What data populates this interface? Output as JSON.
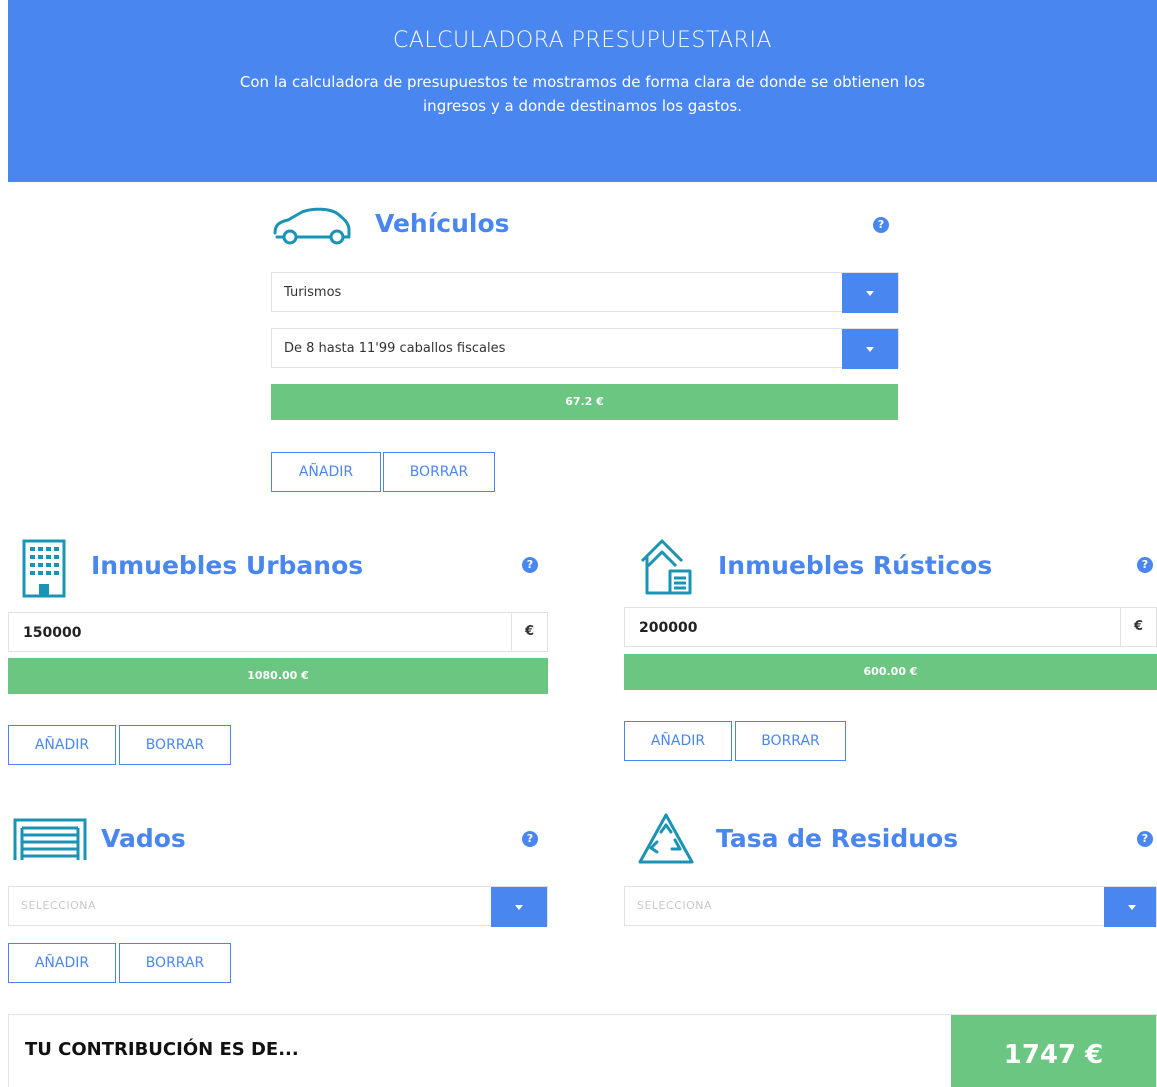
{
  "header": {
    "title": "CALCULADORA PRESUPUESTARIA",
    "subtitle": "Con la calculadora de presupuestos te mostramos de forma clara de donde se obtienen los ingresos y a donde destinamos los gastos."
  },
  "vehiculos": {
    "title": "Vehículos",
    "icon": "car-icon",
    "type_select": "Turismos",
    "power_select": "De 8 hasta 11'99 caballos fiscales",
    "result": "67.2 €",
    "add_label": "AÑADIR",
    "delete_label": "BORRAR"
  },
  "urbanos": {
    "title": "Inmuebles Urbanos",
    "icon": "building-icon",
    "value": "150000",
    "unit": "€",
    "result": "1080.00 €",
    "add_label": "AÑADIR",
    "delete_label": "BORRAR"
  },
  "rusticos": {
    "title": "Inmuebles Rústicos",
    "icon": "house-icon",
    "value": "200000",
    "unit": "€",
    "result": "600.00 €",
    "add_label": "AÑADIR",
    "delete_label": "BORRAR"
  },
  "vados": {
    "title": "Vados",
    "icon": "garage-door-icon",
    "select_placeholder": "SELECCIONA",
    "add_label": "AÑADIR",
    "delete_label": "BORRAR"
  },
  "residuos": {
    "title": "Tasa de Residuos",
    "icon": "recycle-icon",
    "select_placeholder": "SELECCIONA"
  },
  "total": {
    "label": "TU CONTRIBUCIÓN ES DE...",
    "amount": "1747 €"
  },
  "colors": {
    "accent": "#4a86f0",
    "result_green": "#6ac680",
    "icon_teal": "#1a93b5"
  }
}
